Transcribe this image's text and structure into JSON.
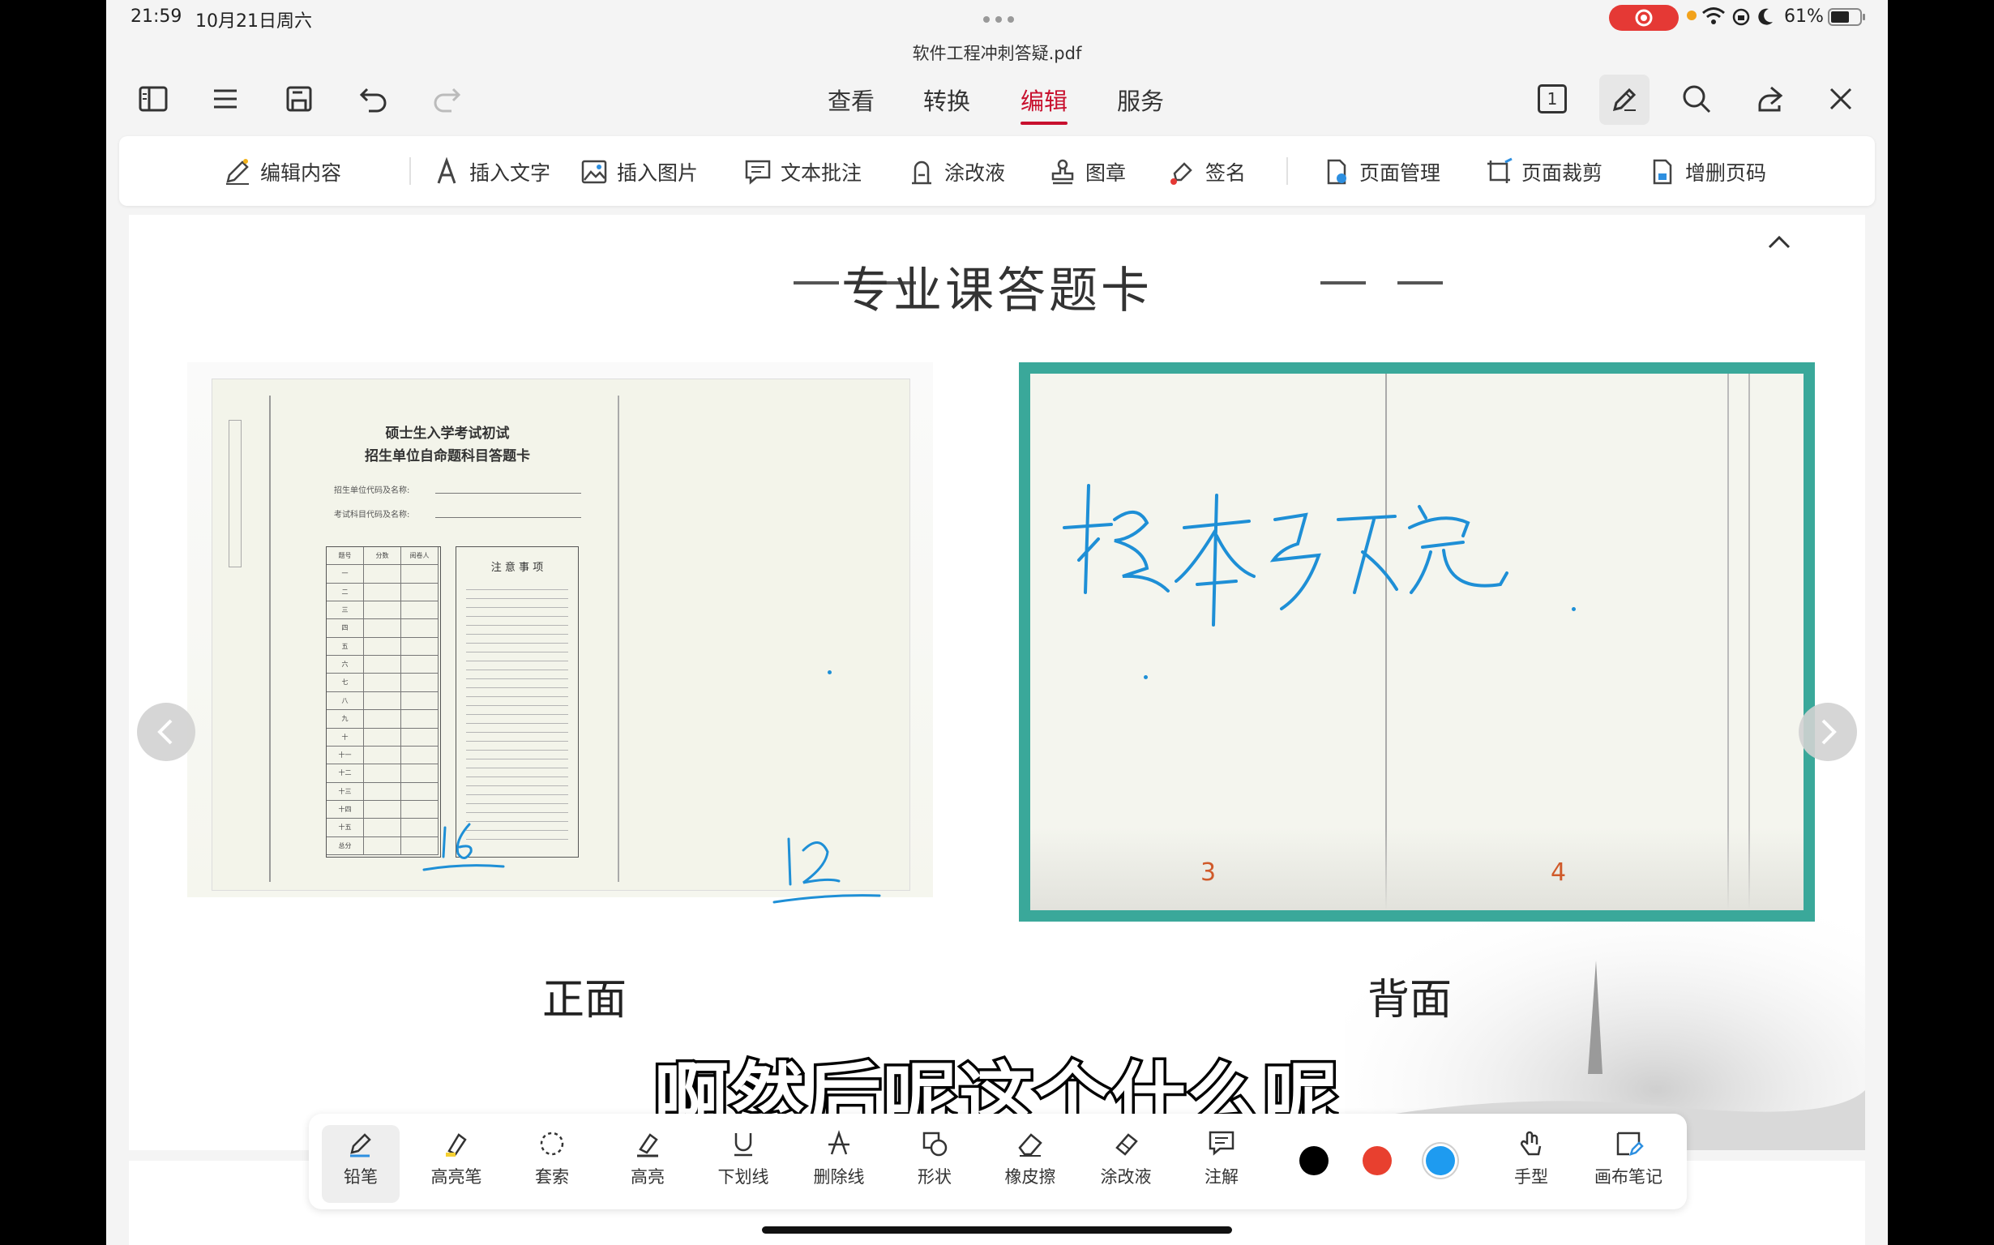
{
  "status": {
    "time": "21:59",
    "date": "10月21日周六",
    "battery": "61%"
  },
  "file": {
    "name": "软件工程冲刺答疑.pdf"
  },
  "nav": {
    "tabs": [
      {
        "label": "查看"
      },
      {
        "label": "转换"
      },
      {
        "label": "编辑",
        "active": true
      },
      {
        "label": "服务"
      }
    ],
    "page_indicator": "1"
  },
  "ribbon": {
    "items": [
      {
        "label": "编辑内容",
        "icon": "edit-content-icon"
      },
      {
        "label": "插入文字",
        "icon": "insert-text-icon"
      },
      {
        "label": "插入图片",
        "icon": "insert-image-icon"
      },
      {
        "label": "文本批注",
        "icon": "text-comment-icon"
      },
      {
        "label": "涂改液",
        "icon": "correction-fluid-icon"
      },
      {
        "label": "图章",
        "icon": "stamp-icon"
      },
      {
        "label": "签名",
        "icon": "signature-icon"
      },
      {
        "label": "页面管理",
        "icon": "page-manage-icon"
      },
      {
        "label": "页面裁剪",
        "icon": "page-crop-icon"
      },
      {
        "label": "增删页码",
        "icon": "page-number-icon"
      }
    ]
  },
  "document": {
    "title": "专业课答题卡",
    "front_caption": "正面",
    "back_caption": "背面",
    "sheet_title_line1": "硕士生入学考试初试",
    "sheet_title_line2": "招生单位自命题科目答题卡",
    "sheet_field1": "招生单位代码及名称:",
    "sheet_field2": "考试科目代码及名称:",
    "notice_title": "注 意 事 项",
    "table_headers": [
      "题号",
      "分数",
      "阅卷人"
    ],
    "table_rows": [
      "一",
      "二",
      "三",
      "四",
      "五",
      "六",
      "七",
      "八",
      "九",
      "十",
      "十一",
      "十二",
      "十三",
      "十四",
      "十五",
      "总分"
    ],
    "handwritten_front_left": "16",
    "handwritten_front_right": "12",
    "handwritten_back": "根本写不完",
    "back_page_left": "3",
    "back_page_right": "4"
  },
  "subtitle": "啊然后呢这个什么呢",
  "pen_toolbar": {
    "tools": [
      {
        "label": "铅笔",
        "active": true
      },
      {
        "label": "高亮笔"
      },
      {
        "label": "套索"
      },
      {
        "label": "高亮"
      },
      {
        "label": "下划线"
      },
      {
        "label": "删除线"
      },
      {
        "label": "形状"
      },
      {
        "label": "橡皮擦"
      },
      {
        "label": "涂改液"
      },
      {
        "label": "注解"
      }
    ],
    "colors": [
      "#000000",
      "#e8402f",
      "#1e9bf0"
    ],
    "extra": [
      {
        "label": "手型"
      },
      {
        "label": "画布笔记"
      }
    ]
  },
  "colors": {
    "accent": "#c8102e",
    "ink": "#1e8fd6",
    "frame": "#3aa89a"
  }
}
